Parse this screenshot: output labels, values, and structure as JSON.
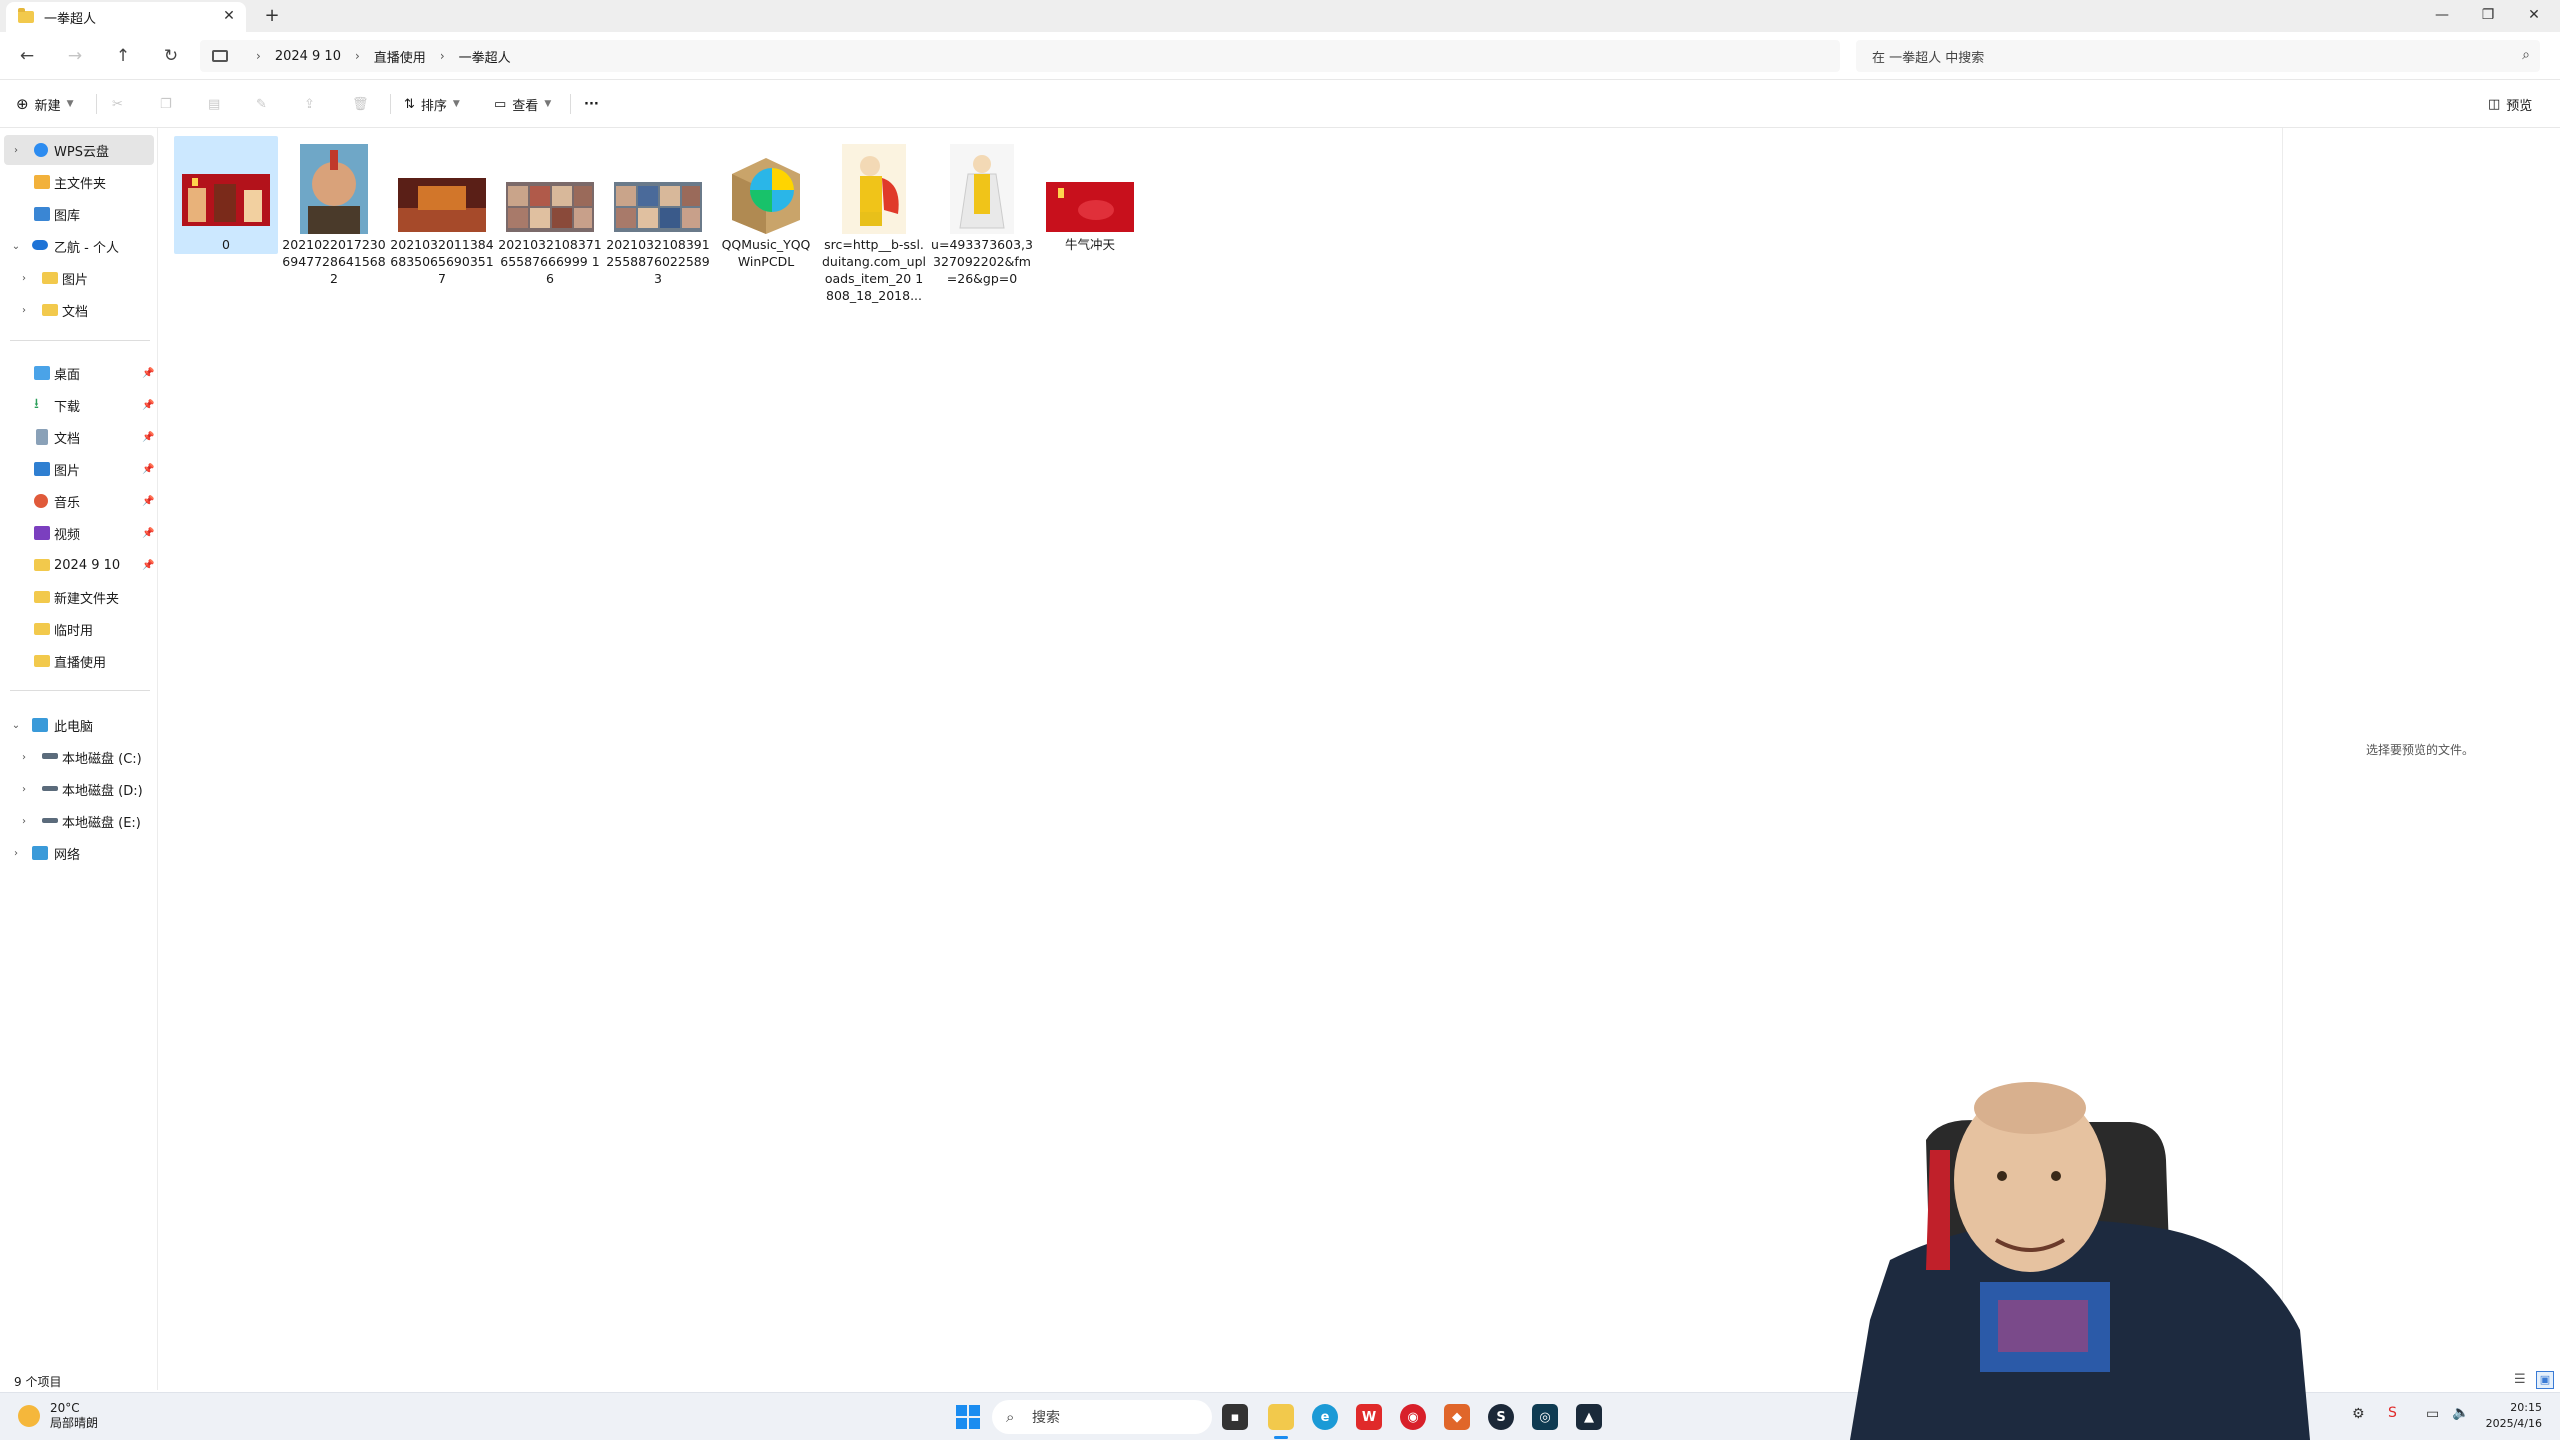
{
  "window": {
    "tab_title": "一拳超人",
    "new_tab": "+",
    "close_tab": "✕",
    "minimize": "—",
    "maximize": "❐",
    "close": "✕"
  },
  "address": {
    "crumbs": [
      "2024 9 10",
      "直播使用",
      "一拳超人"
    ],
    "search_placeholder": "在 一拳超人 中搜索"
  },
  "commands": {
    "new": "新建",
    "sort": "排序",
    "view": "查看",
    "more": "···",
    "preview": "预览"
  },
  "sidebar": {
    "top": [
      {
        "label": "WPS云盘",
        "icon": "wps-cloud-icon"
      },
      {
        "label": "主文件夹",
        "icon": "home-icon"
      },
      {
        "label": "图库",
        "icon": "gallery-icon"
      },
      {
        "label": "乙航 - 个人",
        "icon": "onedrive-icon"
      },
      {
        "label": "图片",
        "icon": "folder-icon"
      },
      {
        "label": "文档",
        "icon": "folder-icon"
      }
    ],
    "quick": [
      {
        "label": "桌面",
        "icon": "desktop-icon"
      },
      {
        "label": "下载",
        "icon": "download-icon"
      },
      {
        "label": "文档",
        "icon": "documents-icon"
      },
      {
        "label": "图片",
        "icon": "pictures-icon"
      },
      {
        "label": "音乐",
        "icon": "music-icon"
      },
      {
        "label": "视频",
        "icon": "videos-icon"
      },
      {
        "label": "2024 9 10",
        "icon": "folder-icon"
      },
      {
        "label": "新建文件夹",
        "icon": "folder-icon"
      },
      {
        "label": "临时用",
        "icon": "folder-icon"
      },
      {
        "label": "直播使用",
        "icon": "folder-icon"
      }
    ],
    "pc": [
      {
        "label": "此电脑",
        "icon": "this-pc-icon"
      },
      {
        "label": "本地磁盘 (C:)",
        "icon": "drive-c-icon"
      },
      {
        "label": "本地磁盘 (D:)",
        "icon": "drive-icon"
      },
      {
        "label": "本地磁盘 (E:)",
        "icon": "drive-icon"
      },
      {
        "label": "网络",
        "icon": "network-icon"
      }
    ]
  },
  "files": [
    {
      "name": "0"
    },
    {
      "name": "20210220172306947728641568 2"
    },
    {
      "name": "20210320113846835065690351 7"
    },
    {
      "name": "202103210837165587666999 16"
    },
    {
      "name": "20210321083912558876022589 3"
    },
    {
      "name": "QQMusic_YQQ WinPCDL"
    },
    {
      "name": "src=http__b-ssl.duitang.com_uploads_item_20 1808_18_2018..."
    },
    {
      "name": "u=493373603,3 327092202&fm =26&gp=0"
    },
    {
      "name": "牛气冲天"
    }
  ],
  "preview_message": "选择要预览的文件。",
  "status": {
    "count": "9 个项目"
  },
  "taskbar": {
    "weather_temp": "20°C",
    "weather_desc": "局部晴朗",
    "search": "搜索",
    "time": "20:15",
    "date": "2025/4/16"
  }
}
